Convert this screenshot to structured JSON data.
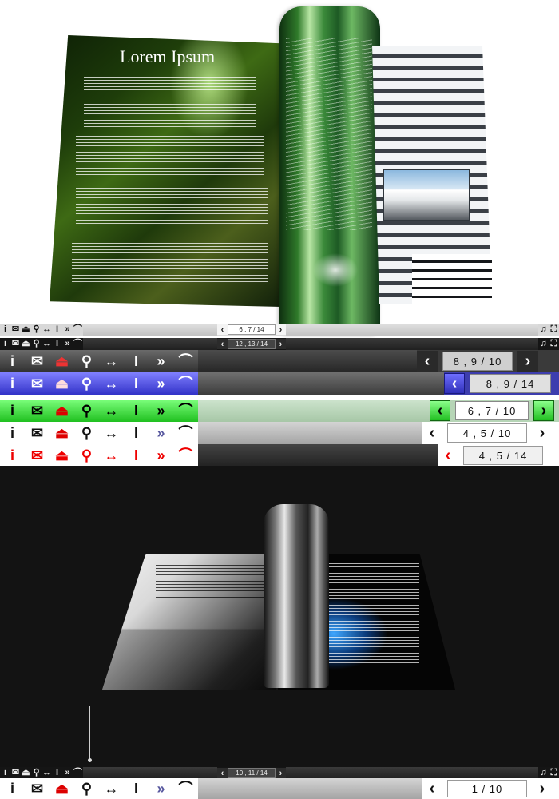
{
  "top_book": {
    "title": "Lorem Ipsum"
  },
  "toolbar_icons": {
    "info": "i",
    "mail": "✉",
    "pdf": "⏏",
    "zoom": "⚲",
    "width": "↔",
    "text": "I",
    "fast_forward": "»",
    "curl": "⌒",
    "prev": "‹",
    "next": "›",
    "headphones": "♫",
    "fullscreen": "⛶"
  },
  "toolbars": {
    "mini_light": {
      "page": "6 , 7 / 14"
    },
    "mini_dark": {
      "page": "12 , 13 / 14"
    },
    "grey": {
      "page": "8 , 9 / 10"
    },
    "blue": {
      "page": "8 , 9 / 14"
    },
    "green": {
      "page": "6 , 7 / 10"
    },
    "white": {
      "page": "4 , 5 / 10"
    },
    "red": {
      "page": "4 , 5 / 14"
    },
    "bottom_mini_dark": {
      "page": "10 , 11 / 14"
    },
    "bottom_white": {
      "page": "1 / 10"
    }
  },
  "colors": {
    "grey_theme": "#3a3a3a",
    "blue_theme": "#3232c8",
    "green_theme": "#20c020",
    "red_theme": "#e00000",
    "dark_scene_bg": "#131313"
  }
}
